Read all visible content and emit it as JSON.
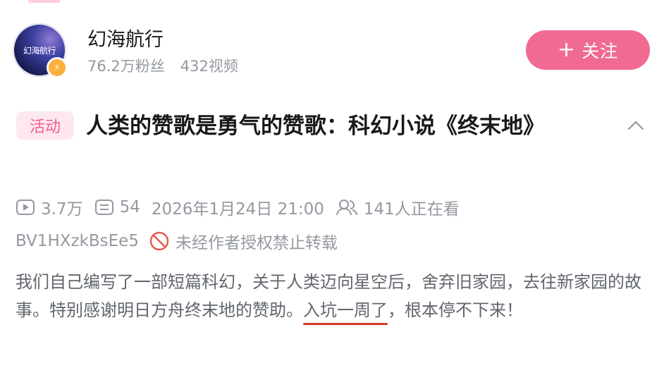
{
  "channel": {
    "name": "幻海航行",
    "avatar_text": "幻海航行",
    "followers": "76.2万粉丝",
    "videos": "432视频",
    "follow_label": "关注"
  },
  "video": {
    "tag": "活动",
    "title": "人类的赞歌是勇气的赞歌：科幻小说《终末地》",
    "views": "3.7万",
    "comments": "54",
    "datetime": "2026年1月24日 21:00",
    "watching": "141人正在看",
    "bvid": "BV1HXzkBsEe5",
    "copyright": "未经作者授权禁止转载"
  },
  "description": {
    "part1": "我们自己编写了一部短篇科幻，关于人类迈向星空后，舍弃旧家园，去往新家园的故事。特别感谢明日方舟终末地的赞助。",
    "highlight": "入坑一周了",
    "part2": "，根本停不下来！"
  },
  "colors": {
    "accent_pink": "#f16a92",
    "tag_bg": "#fde8ee",
    "meta_gray": "#9499a0",
    "underline_red": "#d43a2f"
  },
  "icons": [
    "play-icon",
    "comment-icon",
    "viewers-icon",
    "forbidden-icon",
    "chevron-up-icon",
    "verified-badge-icon"
  ]
}
